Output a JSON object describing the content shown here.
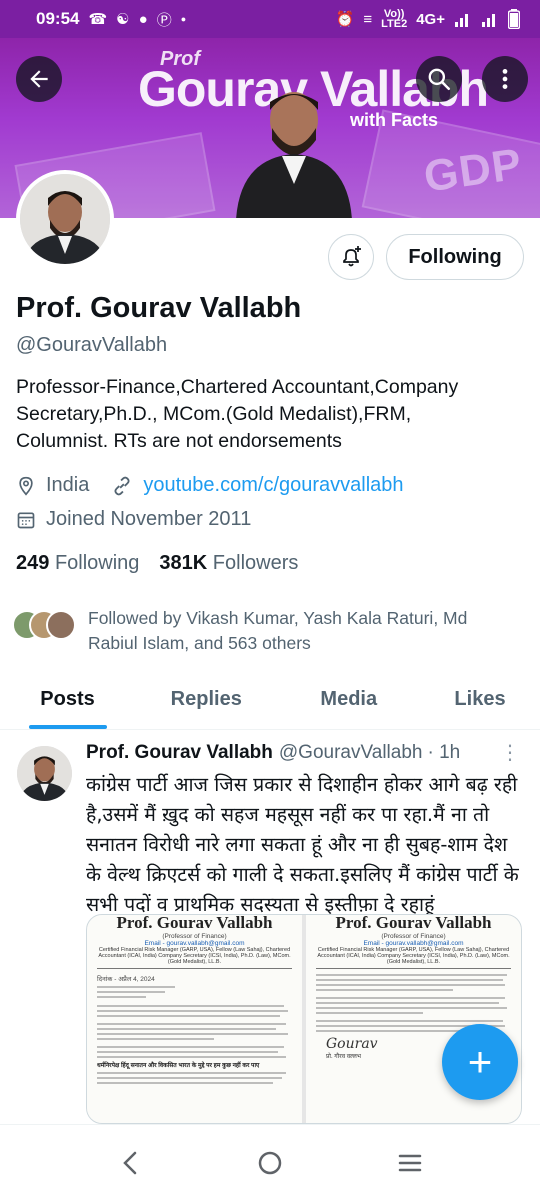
{
  "status_bar": {
    "time": "09:54",
    "network_label_top": "Vo))",
    "network_label_bottom": "LTE2",
    "network_type": "4G+",
    "notification_icons": [
      "whatsapp-icon",
      "snapchat-icon",
      "chat-icon",
      "c-icon",
      "dot-icon"
    ],
    "system_icons": [
      "alarm-icon",
      "vibrate-icon",
      "signal-icon",
      "signal-icon",
      "battery-icon"
    ]
  },
  "banner": {
    "brand_prof": "Prof",
    "brand_name": "Gourav Vallabh",
    "brand_tag": "with Facts",
    "watermark": "GDP",
    "colors": {
      "base": "#8e24aa",
      "light": "#b264d8"
    }
  },
  "header_buttons": {
    "back": "back-arrow-icon",
    "search": "search-icon",
    "more": "more-vertical-icon"
  },
  "profile": {
    "name": "Prof. Gourav Vallabh",
    "handle": "@GouravVallabh",
    "bio_line1": "Professor-Finance,Chartered Accountant,Company",
    "bio_line2": "Secretary,Ph.D., MCom.(Gold Medalist),FRM,",
    "bio_line3": "Columnist. RTs are not endorsements",
    "location": "India",
    "website": "youtube.com/c/gouravvallabh",
    "joined": "Joined November 2011",
    "following_count": "249",
    "following_label": "Following",
    "followers_count": "381K",
    "followers_label": "Followers",
    "followed_by_line1": "Followed by Vikash Kumar, Yash Kala Raturi, Md",
    "followed_by_line2": "Rabiul Islam, and 563 others"
  },
  "actions": {
    "following_button": "Following",
    "notify_icon": "bell-plus-icon"
  },
  "tabs": [
    {
      "label": "Posts",
      "active": true
    },
    {
      "label": "Replies",
      "active": false
    },
    {
      "label": "Media",
      "active": false
    },
    {
      "label": "Likes",
      "active": false
    }
  ],
  "tweet": {
    "author": "Prof. Gourav Vallabh",
    "handle": "@GouravVallabh",
    "time": "· 1h",
    "more": "⋮",
    "text_line1": "कांग्रेस पार्टी आज जिस प्रकार से दिशाहीन होकर आगे बढ़ रही",
    "text_line2": "है,उसमें मैं ख़ुद को सहज महसूस नहीं कर पा रहा.मैं ना तो",
    "text_line3": "सनातन विरोधी नारे लगा सकता हूं और ना ही सुबह-शाम देश",
    "text_line4": "के वेल्थ क्रिएटर्स को गाली दे सकता.इसलिए मैं कांग्रेस पार्टी के",
    "text_line5": "सभी पदों व प्राथमिक सदस्यता से इस्तीफ़ा दे रहाहूं",
    "doc_title": "Prof. Gourav Vallabh",
    "doc_subtitle": "(Professor of Finance)",
    "doc_email": "Email - gourav.vallabh@gmail.com",
    "doc_credentials": "Certified Financial Risk Manager (GARP, USA), Fellow (Law Sahaj), Chartered Accountant (ICAI, India) Company Secretary (ICSI, India), Ph.D. (Law), MCom. (Gold Medalist), LL.B.",
    "doc_date": "दिनांक - अप्रैल 4, 2024",
    "doc_bold_line": "धर्मनिरपेक्ष हिंदू सनातन और विकसित भारत के मुद्दे पर हम कुछ नहीं कर पाए",
    "doc_signature": "Gourav",
    "doc_sign_name": "प्रो. गौरव वल्लभ"
  },
  "fab": {
    "icon": "compose-plus-icon",
    "label": "+"
  },
  "navbar": {
    "back": "nav-back-icon",
    "home": "nav-home-icon",
    "recents": "nav-recents-icon"
  }
}
